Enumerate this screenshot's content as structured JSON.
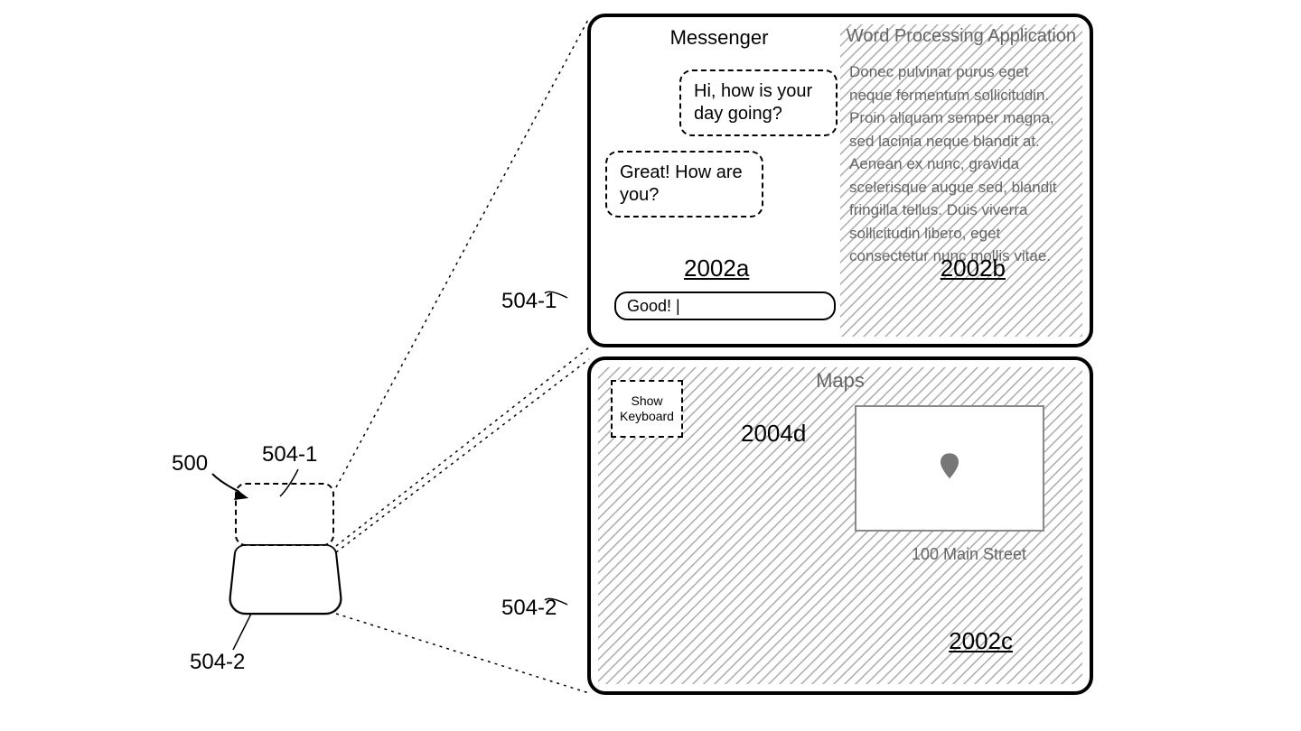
{
  "refs": {
    "r500": "500",
    "r504_1_left": "504-1",
    "r504_2_left": "504-2",
    "r504_1_right": "504-1",
    "r504_2_right": "504-2",
    "r2002a": "2002a",
    "r2002b": "2002b",
    "r2002c": "2002c",
    "r2004d": "2004d"
  },
  "top_screen": {
    "left": {
      "title": "Messenger",
      "bubble1": "Hi, how is your day going?",
      "bubble2": "Great! How are you?",
      "input_value": "Good! |"
    },
    "right": {
      "title": "Word Processing Application",
      "body": "Donec pulvinar purus eget neque fermentum sollicitudin. Proin aliquam semper magna, sed lacinia neque blandit at. Aenean ex nunc, gravida scelerisque augue sed, blandit fringilla tellus. Duis viverra sollicitudin libero, eget consectetur nunc mollis vitae."
    }
  },
  "bottom_screen": {
    "show_keyboard": "Show Keyboard",
    "maps_title": "Maps",
    "address": "100 Main Street"
  }
}
